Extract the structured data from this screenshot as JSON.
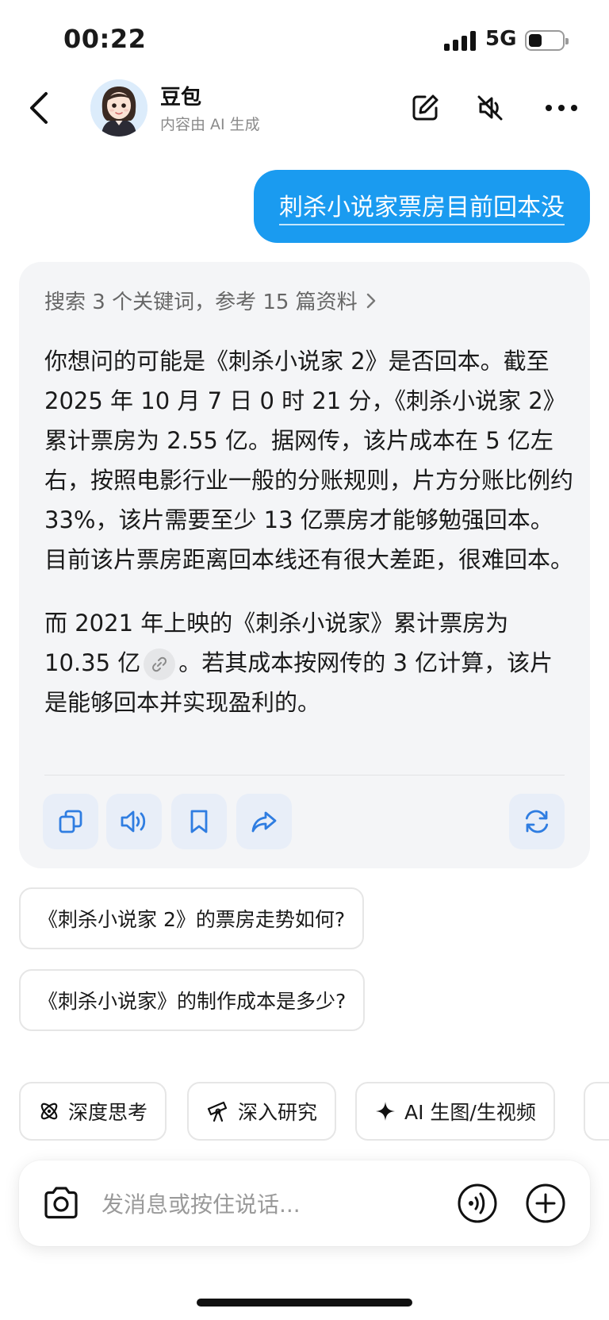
{
  "status_bar": {
    "time": "00:22",
    "network": "5G",
    "battery_level": 0.35
  },
  "header": {
    "title": "豆包",
    "subtitle": "内容由 AI 生成"
  },
  "user_message": "刺杀小说家票房目前回本没",
  "ai_response": {
    "search_note": "搜索 3 个关键词，参考 15 篇资料",
    "paragraph_1": "你想问的可能是《刺杀小说家 2》是否回本。截至 2025 年 10 月 7 日 0 时 21 分，《刺杀小说家 2》累计票房为 2.55 亿。据网传，该片成本在 5 亿左右，按照电影行业一般的分账规则，片方分账比例约 33%，该片需要至少 13 亿票房才能够勉强回本。目前该片票房距离回本线还有很大差距，很难回本。",
    "paragraph_2_a": "而 2021 年上映的《刺杀小说家》累计票房为 10.35 亿",
    "paragraph_2_b": "。若其成本按网传的 3 亿计算，该片是能够回本并实现盈利的。"
  },
  "suggestions": [
    "《刺杀小说家 2》的票房走势如何?",
    "《刺杀小说家》的制作成本是多少?"
  ],
  "tools": [
    {
      "label": "深度思考",
      "icon": "atom-icon"
    },
    {
      "label": "深入研究",
      "icon": "telescope-icon"
    },
    {
      "label": "AI 生图/生视频",
      "icon": "sparkle-icon"
    }
  ],
  "input": {
    "placeholder": "发消息或按住说话..."
  },
  "colors": {
    "accent": "#1a9bf0",
    "card_bg": "#f4f5f7",
    "icon_blue": "#2f7de1"
  }
}
